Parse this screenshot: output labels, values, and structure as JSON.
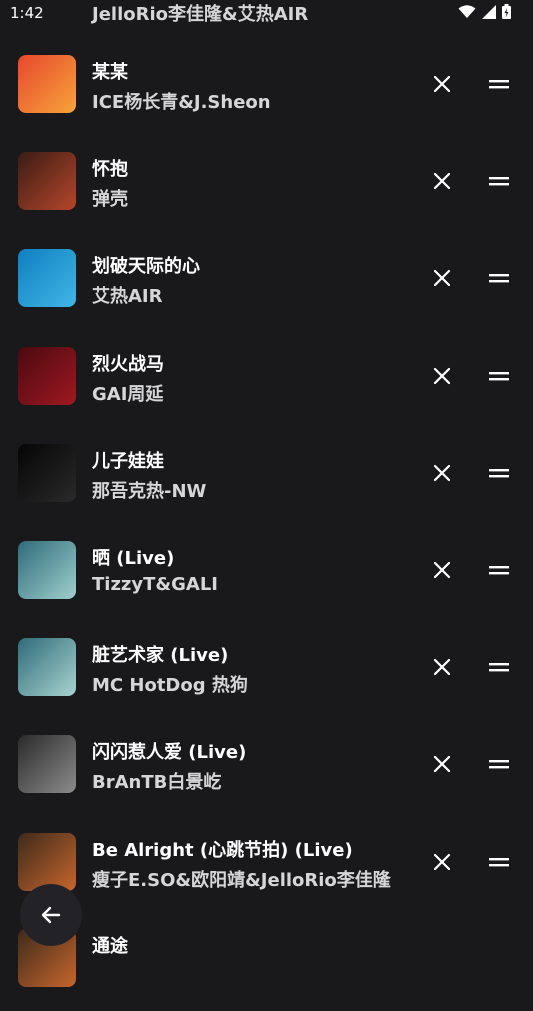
{
  "status_bar": {
    "time": "1:42"
  },
  "top_partial": {
    "artist": "JelloRio李佳隆&艾热AIR"
  },
  "songs": [
    {
      "title": "某某",
      "artist": "ICE杨长青&J.Sheon",
      "colors": [
        "#e6482e",
        "#f8a33a"
      ]
    },
    {
      "title": "怀抱",
      "artist": "弹壳",
      "colors": [
        "#3a1d14",
        "#b6452b"
      ]
    },
    {
      "title": "划破天际的心",
      "artist": "艾热AIR",
      "colors": [
        "#0f7fc0",
        "#41b6e6"
      ]
    },
    {
      "title": "烈火战马",
      "artist": "GAI周延",
      "colors": [
        "#4a0a0e",
        "#a01822"
      ]
    },
    {
      "title": "儿子娃娃",
      "artist": "那吾克热-NW",
      "colors": [
        "#050505",
        "#2a2a2a"
      ]
    },
    {
      "title": "晒 (Live)",
      "artist": "TizzyT&GALI",
      "colors": [
        "#2e6b7a",
        "#9fd0cc"
      ]
    },
    {
      "title": "脏艺术家 (Live)",
      "artist": "MC HotDog 热狗",
      "colors": [
        "#2e6b7a",
        "#a8d4cf"
      ]
    },
    {
      "title": "闪闪惹人爱 (Live)",
      "artist": "BrAnTB白景屹",
      "colors": [
        "#2a2a2a",
        "#8c8c8c"
      ]
    },
    {
      "title": "Be Alright (心跳节拍) (Live)",
      "artist": "瘦子E.SO&欧阳靖&JelloRio李佳隆",
      "colors": [
        "#3d2a1a",
        "#c8662d"
      ]
    }
  ],
  "bottom_partial": {
    "title": "通途"
  },
  "icons": {
    "remove": "close-icon",
    "drag": "drag-handle-icon",
    "back": "arrow-left-icon"
  }
}
